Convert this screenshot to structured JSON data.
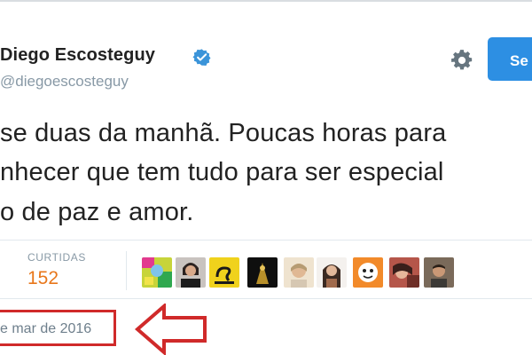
{
  "tweet": {
    "author_name": "Diego Escosteguy",
    "handle": "@diegoescosteguy",
    "lines": [
      "se duas da manhã. Poucas horas para",
      "nhecer que tem tudo para ser especial",
      "o de paz e amor."
    ],
    "likes_label": "CURTIDAS",
    "likes_count": "152",
    "date": "e mar de 2016"
  },
  "follow_button": {
    "label": "Se"
  },
  "icons": {
    "verified": "verified-badge-icon",
    "settings": "gear-icon"
  },
  "colors": {
    "accent_blue": "#2d8fe3",
    "likes_orange": "#e8771b",
    "annotation_red": "#d02a2a",
    "muted_gray": "#8899a6"
  },
  "liked_by_avatars": [
    {
      "name": "avatar-1"
    },
    {
      "name": "avatar-2"
    },
    {
      "name": "avatar-3"
    },
    {
      "name": "avatar-4"
    },
    {
      "name": "avatar-5"
    },
    {
      "name": "avatar-6"
    },
    {
      "name": "avatar-7"
    },
    {
      "name": "avatar-8"
    },
    {
      "name": "avatar-9"
    },
    {
      "name": "avatar-10"
    }
  ]
}
